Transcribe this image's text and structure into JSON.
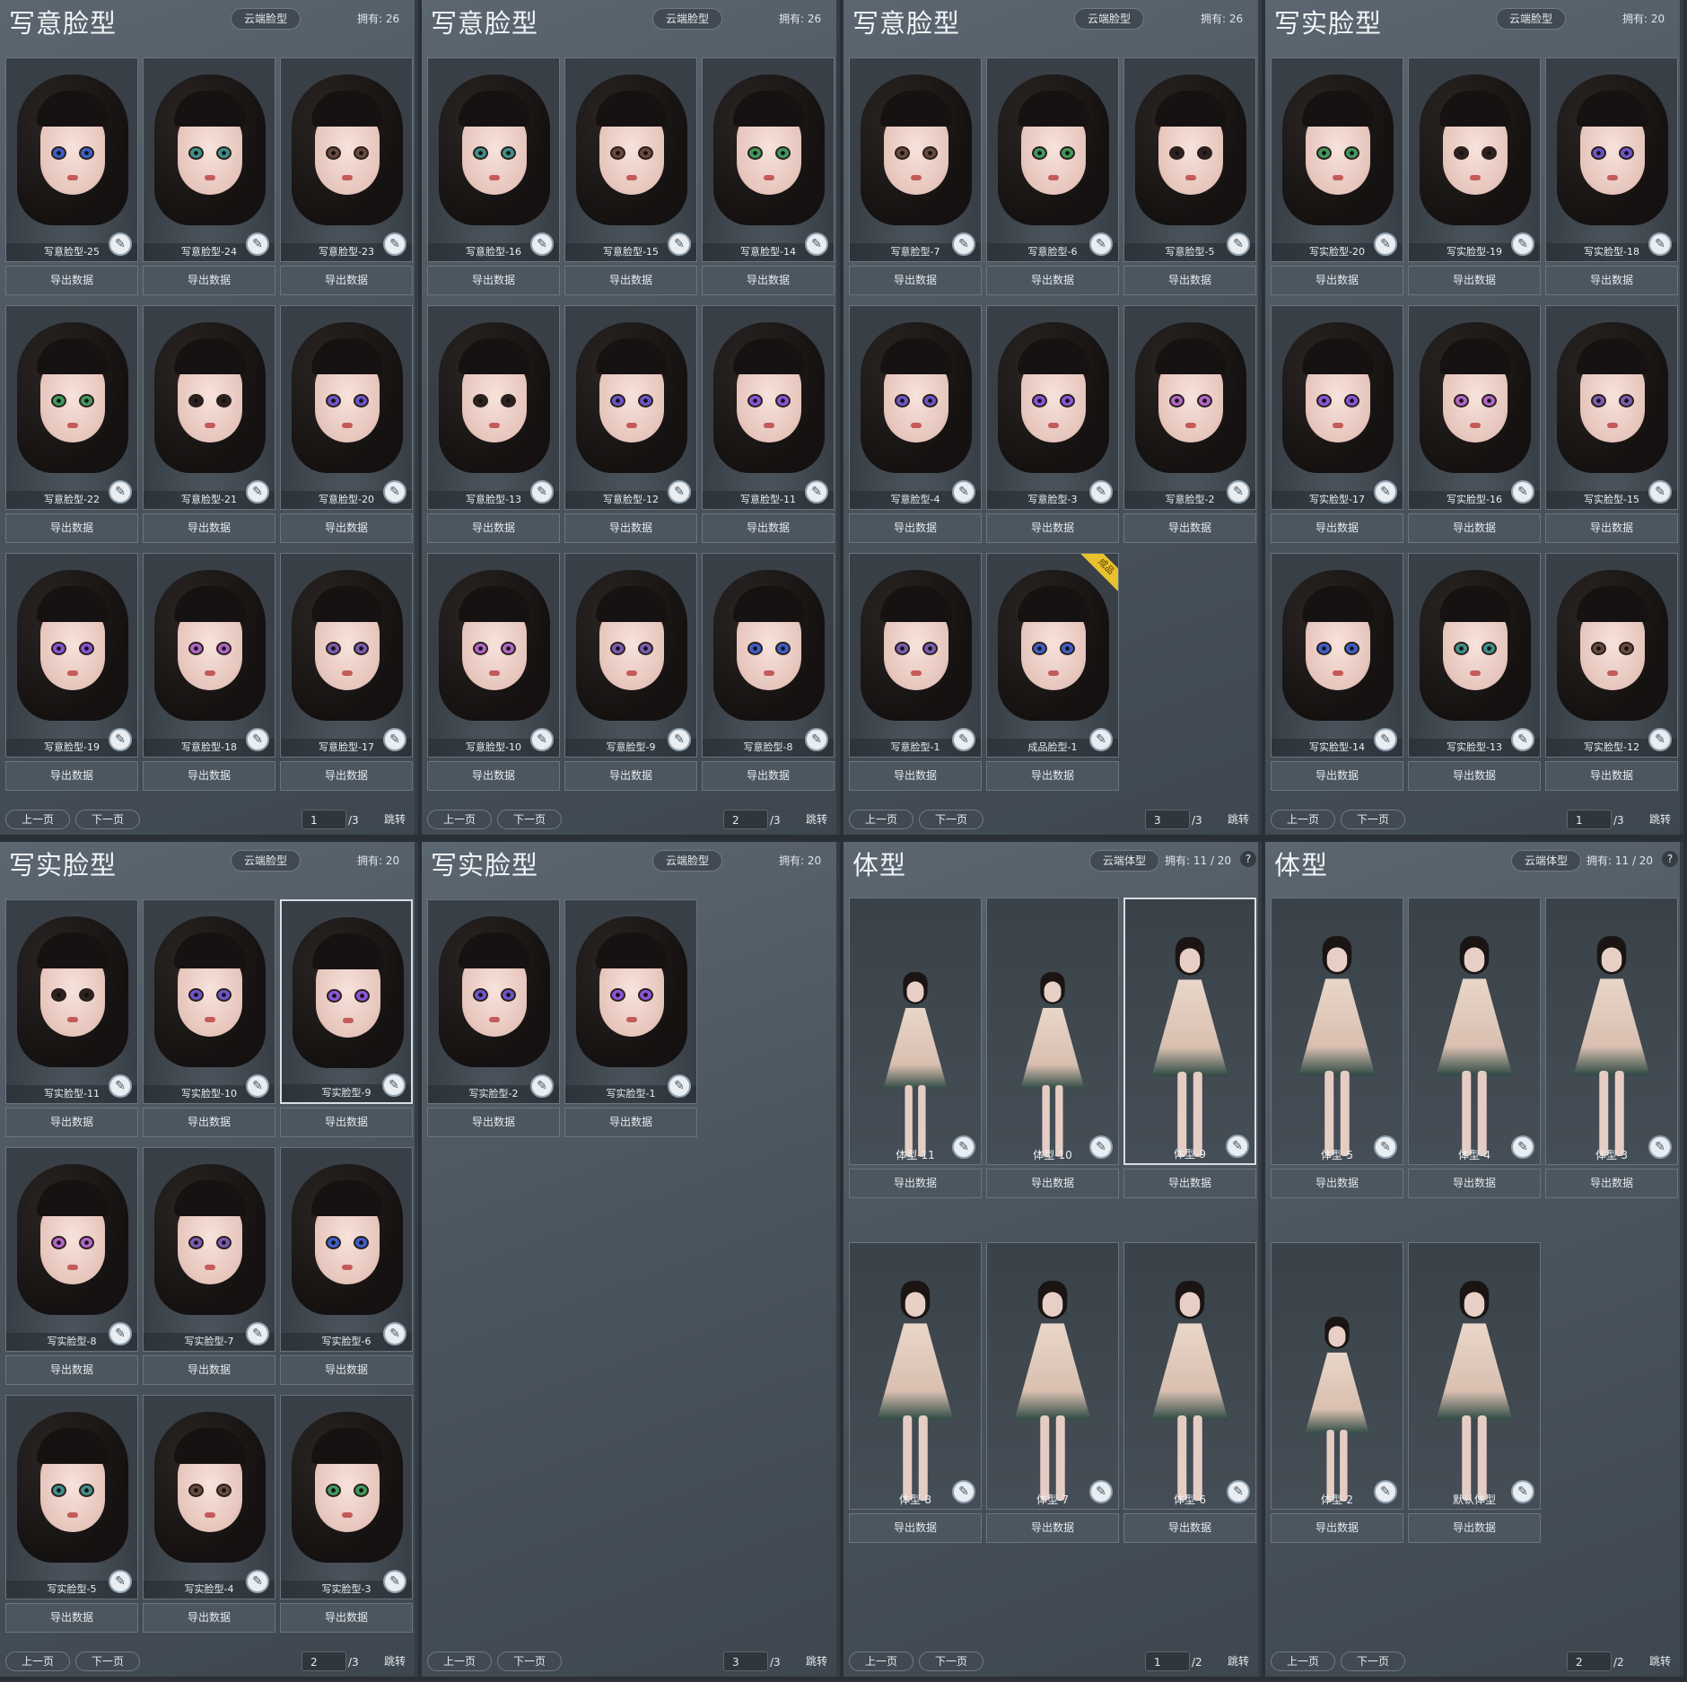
{
  "common": {
    "export": "导出数据",
    "prev": "上一页",
    "next": "下一页",
    "jump": "跳转",
    "help": "?",
    "tag_finished": "成品",
    "brush_icon": "✎"
  },
  "panels": [
    {
      "title": "写意脸型",
      "btn": "云端脸型",
      "owned": "拥有:  26",
      "kind": "face",
      "selected": -1,
      "page": "1",
      "total": "/3",
      "cards": [
        "写意脸型-25",
        "写意脸型-24",
        "写意脸型-23",
        "写意脸型-22",
        "写意脸型-21",
        "写意脸型-20",
        "写意脸型-19",
        "写意脸型-18",
        "写意脸型-17"
      ]
    },
    {
      "title": "写意脸型",
      "btn": "云端脸型",
      "owned": "拥有:  26",
      "kind": "face",
      "selected": -1,
      "page": "2",
      "total": "/3",
      "cards": [
        "写意脸型-16",
        "写意脸型-15",
        "写意脸型-14",
        "写意脸型-13",
        "写意脸型-12",
        "写意脸型-11",
        "写意脸型-10",
        "写意脸型-9",
        "写意脸型-8"
      ]
    },
    {
      "title": "写意脸型",
      "btn": "云端脸型",
      "owned": "拥有:  26",
      "kind": "face",
      "selected": -1,
      "page": "3",
      "total": "/3",
      "cards": [
        "写意脸型-7",
        "写意脸型-6",
        "写意脸型-5",
        "写意脸型-4",
        "写意脸型-3",
        "写意脸型-2",
        "写意脸型-1",
        "成品脸型-1"
      ]
    },
    {
      "title": "写实脸型",
      "btn": "云端脸型",
      "owned": "拥有:  20",
      "kind": "face",
      "selected": -1,
      "page": "1",
      "total": "/3",
      "cards": [
        "写实脸型-20",
        "写实脸型-19",
        "写实脸型-18",
        "写实脸型-17",
        "写实脸型-16",
        "写实脸型-15",
        "写实脸型-14",
        "写实脸型-13",
        "写实脸型-12"
      ]
    },
    {
      "title": "写实脸型",
      "btn": "云端脸型",
      "owned": "拥有:  20",
      "kind": "face",
      "selected": 2,
      "page": "2",
      "total": "/3",
      "cards": [
        "写实脸型-11",
        "写实脸型-10",
        "写实脸型-9",
        "写实脸型-8",
        "写实脸型-7",
        "写实脸型-6",
        "写实脸型-5",
        "写实脸型-4",
        "写实脸型-3"
      ]
    },
    {
      "title": "写实脸型",
      "btn": "云端脸型",
      "owned": "拥有:  20",
      "kind": "face",
      "selected": -1,
      "page": "3",
      "total": "/3",
      "cards": [
        "写实脸型-2",
        "写实脸型-1"
      ]
    },
    {
      "title": "体型",
      "btn": "云端体型",
      "owned": "拥有:  11 / 20",
      "kind": "body",
      "selected": 2,
      "page": "1",
      "total": "/2",
      "help": true,
      "cards": [
        "体型-11",
        "体型-10",
        "体型-9",
        "体型-8",
        "体型-7",
        "体型-6"
      ]
    },
    {
      "title": "体型",
      "btn": "云端体型",
      "owned": "拥有:  11 / 20",
      "kind": "body",
      "selected": -1,
      "page": "2",
      "total": "/2",
      "help": true,
      "cards": [
        "体型-5",
        "体型-4",
        "体型-3",
        "体型-2",
        "默认体型"
      ]
    }
  ],
  "colors": {
    "eye": [
      "#3d5fc9",
      "#3f8f8a",
      "#6a4a3c",
      "#3f9a5a",
      "#2e2220",
      "#6d55c8",
      "#8a55d8",
      "#b266c8",
      "#7a5cb0"
    ]
  }
}
